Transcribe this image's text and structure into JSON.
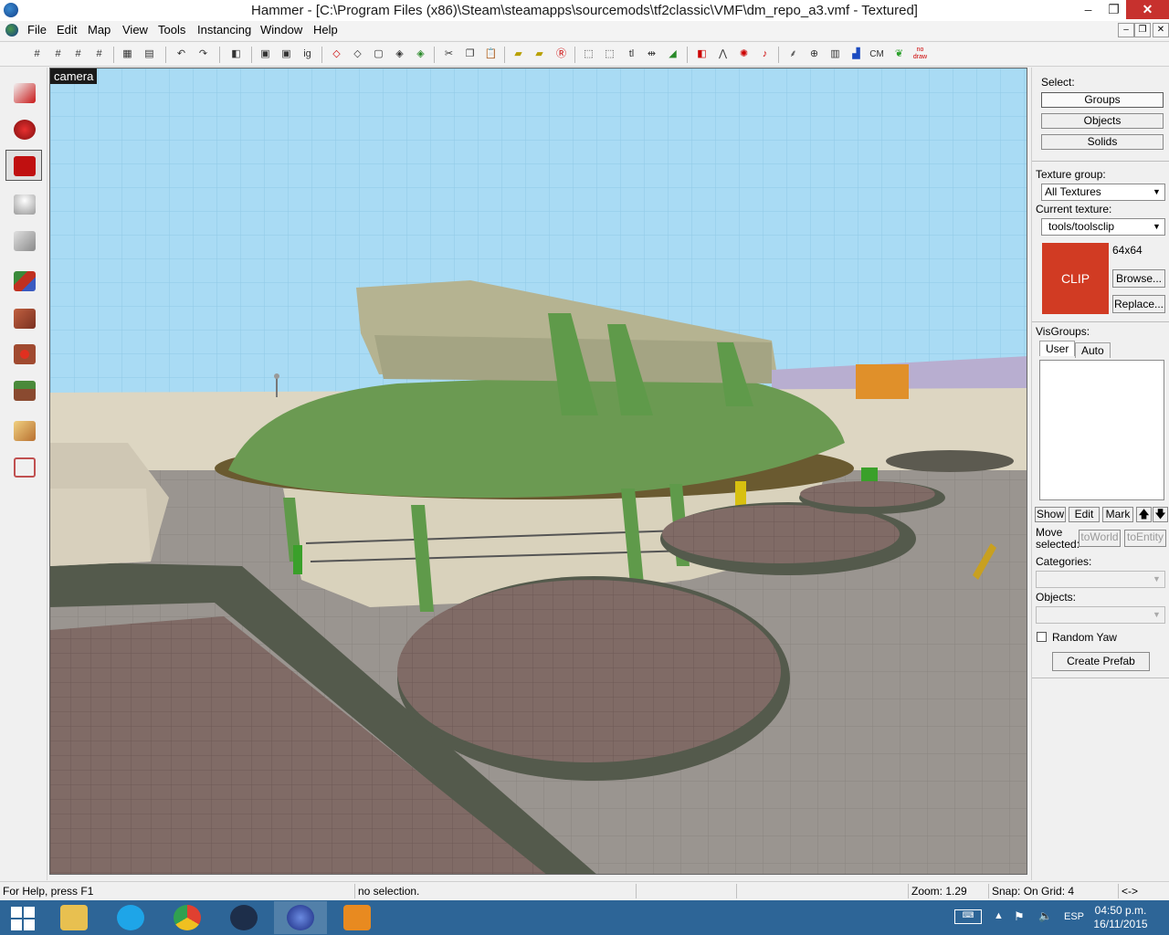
{
  "window": {
    "title": "Hammer - [C:\\Program Files (x86)\\Steam\\steamapps\\sourcemods\\tf2classic\\VMF\\dm_repo_a3.vmf - Textured]",
    "minimize": "–",
    "maximize": "❐",
    "close": "✕"
  },
  "menu": {
    "items": [
      "File",
      "Edit",
      "Map",
      "View",
      "Tools",
      "Instancing",
      "Window",
      "Help"
    ],
    "mdi_min": "–",
    "mdi_restore": "❐",
    "mdi_close": "✕"
  },
  "toolbar": {
    "texture_lock": "tl",
    "camera_mode": "CM",
    "nodraw_line1": "no",
    "nodraw_line2": "draw",
    "ignore_groups": "ig"
  },
  "tools": [
    {
      "name": "selection-tool",
      "color": "#c81818"
    },
    {
      "name": "magnify-tool",
      "color": "#c81818"
    },
    {
      "name": "camera-tool",
      "color": "#b01010"
    },
    {
      "name": "entity-tool",
      "color": "#b0b0b0"
    },
    {
      "name": "block-tool",
      "color": "#9a9a9a"
    },
    {
      "name": "texture-application-tool",
      "color": "#4a8a3a"
    },
    {
      "name": "apply-current-texture-tool",
      "color": "#a04a30"
    },
    {
      "name": "decal-tool",
      "color": "#c03020"
    },
    {
      "name": "overlay-tool",
      "color": "#5a7a3a"
    },
    {
      "name": "clipping-tool",
      "color": "#d8a040"
    },
    {
      "name": "vertex-tool",
      "color": "#c05050"
    }
  ],
  "viewport": {
    "label": "camera"
  },
  "panel": {
    "select_label": "Select:",
    "groups": "Groups",
    "objects": "Objects",
    "solids": "Solids",
    "texture_group_label": "Texture group:",
    "texture_group_value": "All Textures",
    "current_texture_label": "Current texture:",
    "current_texture_value": "tools/toolsclip",
    "texture_preview_text": "CLIP",
    "texture_size": "64x64",
    "browse": "Browse...",
    "replace": "Replace...",
    "visgroups_label": "VisGroups:",
    "tab_user": "User",
    "tab_auto": "Auto",
    "show": "Show",
    "edit": "Edit",
    "mark": "Mark",
    "up": "🡅",
    "down": "🡇",
    "move_line1": "Move",
    "move_line2": "selected:",
    "to_world": "toWorld",
    "to_entity": "toEntity",
    "categories_label": "Categories:",
    "objects_label": "Objects:",
    "random_yaw": "Random Yaw",
    "create_prefab": "Create Prefab"
  },
  "status": {
    "help": "For Help, press F1",
    "selection": "no selection.",
    "zoom": "Zoom: 1.29",
    "snap": "Snap: On Grid: 4",
    "extra": "<->"
  },
  "taskbar": {
    "apps": [
      {
        "name": "file-explorer",
        "color": "#e8c050"
      },
      {
        "name": "skype",
        "color": "#1ea5e8"
      },
      {
        "name": "chrome",
        "color": "#e04030"
      },
      {
        "name": "steam",
        "color": "#1d2e4a"
      },
      {
        "name": "hammer",
        "color": "#3a5ac0"
      },
      {
        "name": "media-player",
        "color": "#e88a20"
      }
    ],
    "language": "ESP",
    "time": "04:50 p.m.",
    "date": "16/11/2015"
  }
}
